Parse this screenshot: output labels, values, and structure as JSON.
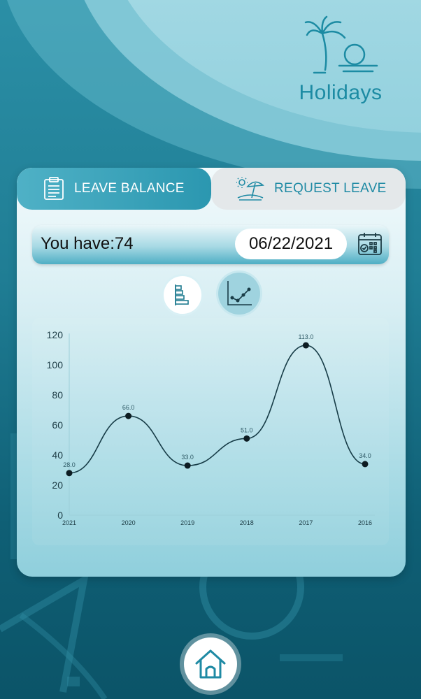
{
  "header": {
    "title": "Holidays",
    "icon": "palm-beach-icon"
  },
  "tabs": [
    {
      "label": "LEAVE BALANCE",
      "icon": "clipboard-icon",
      "active": true
    },
    {
      "label": "REQUEST LEAVE",
      "icon": "beach-umbrella-icon",
      "active": false
    }
  ],
  "balance": {
    "label": "You have:",
    "value": "74"
  },
  "date": {
    "value": "06/22/2021",
    "icon": "calendar-icon"
  },
  "chart_toggle": [
    {
      "icon": "bar-chart-icon",
      "selected": false
    },
    {
      "icon": "line-chart-icon",
      "selected": true
    }
  ],
  "chart_data": {
    "type": "line",
    "categories": [
      "2021",
      "2020",
      "2019",
      "2018",
      "2017",
      "2016"
    ],
    "values": [
      28.0,
      66.0,
      33.0,
      51.0,
      113.0,
      34.0
    ],
    "value_labels": [
      "28.0",
      "66.0",
      "33.0",
      "51.0",
      "113.0",
      "34.0"
    ],
    "yticks": [
      "0",
      "20",
      "40",
      "60",
      "80",
      "100",
      "120"
    ],
    "ylim": [
      0,
      120
    ],
    "smooth": true,
    "grid": false
  },
  "footer": {
    "home_icon": "home-icon"
  }
}
